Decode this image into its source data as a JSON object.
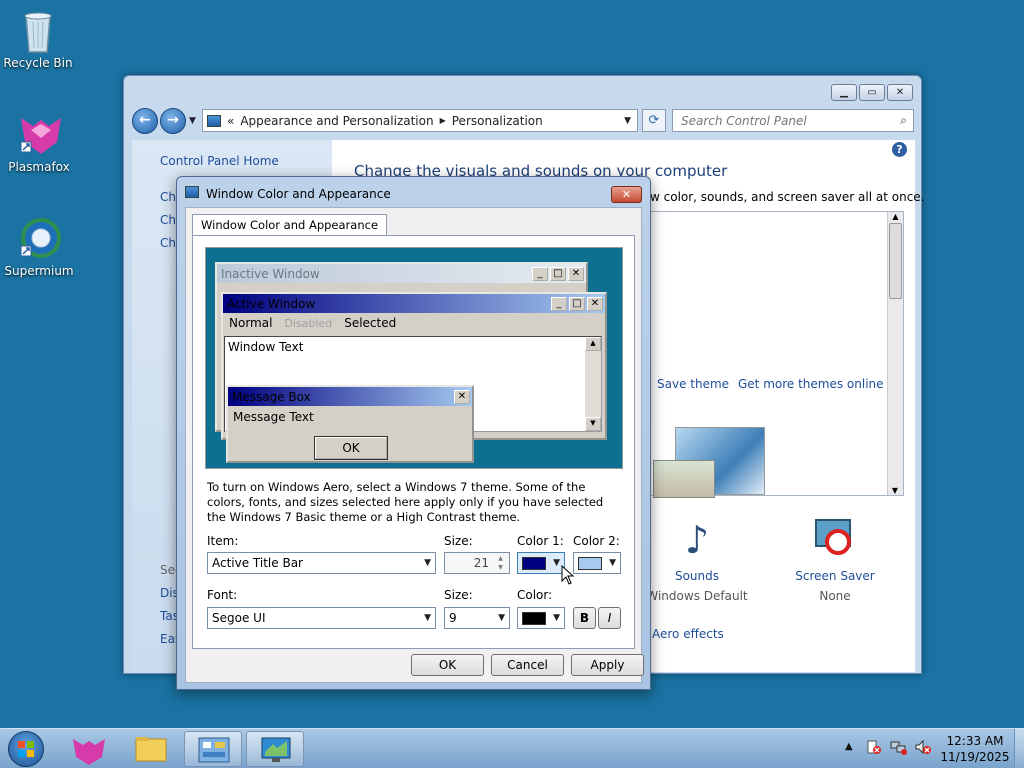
{
  "desktop": {
    "icons": [
      {
        "label": "Recycle Bin",
        "icon": "recycle-bin-icon"
      },
      {
        "label": "Plasmafox",
        "icon": "plasmafox-icon"
      },
      {
        "label": "Supermium",
        "icon": "supermium-icon"
      }
    ]
  },
  "control_panel": {
    "breadcrumb": [
      "Appearance and Personalization",
      "Personalization"
    ],
    "breadcrumb_prefix": "«",
    "search_placeholder": "Search Control Panel",
    "left_home": "Control Panel Home",
    "left_links": [
      "Ch",
      "Ch",
      "Ch"
    ],
    "left_see_also": "See",
    "left_bottom_links": [
      "Dis",
      "Tas",
      "Eas"
    ],
    "heading": "Change the visuals and sounds on your computer",
    "subtext": "w color, sounds, and screen saver all at once.",
    "theme_links": [
      "Save theme",
      "Get more themes online"
    ],
    "bottom_items": [
      {
        "label": "Sounds",
        "sub": "Windows Default",
        "icon": "sounds-icon"
      },
      {
        "label": "Screen Saver",
        "sub": "None",
        "icon": "screen-saver-icon"
      }
    ],
    "aero_link": "Aero effects"
  },
  "dialog": {
    "title": "Window Color and Appearance",
    "tab": "Window Color and Appearance",
    "preview": {
      "inactive_title": "Inactive Window",
      "active_title": "Active Window",
      "menu": [
        "Normal",
        "Disabled",
        "Selected"
      ],
      "window_text": "Window Text",
      "msgbox_title": "Message Box",
      "msgbox_text": "Message Text",
      "ok": "OK"
    },
    "description": "To turn on Windows Aero, select a Windows 7 theme.  Some of the colors, fonts, and sizes selected here apply only if you have selected the Windows 7 Basic theme or a High Contrast theme.",
    "item_label": "Item:",
    "item_value": "Active Title Bar",
    "size_label": "Size:",
    "size_value": "21",
    "color1_label": "Color 1:",
    "color2_label": "Color 2:",
    "font_label": "Font:",
    "font_value": "Segoe UI",
    "font_size_label": "Size:",
    "font_size_value": "9",
    "font_color_label": "Color:",
    "bold_label": "B",
    "italic_label": "I",
    "buttons": {
      "ok": "OK",
      "cancel": "Cancel",
      "apply": "Apply"
    },
    "colors": {
      "color1": "#000080",
      "color2": "#a6caf0",
      "font_color": "#000000"
    }
  },
  "taskbar": {
    "time": "12:33 AM",
    "date": "11/19/2025"
  }
}
